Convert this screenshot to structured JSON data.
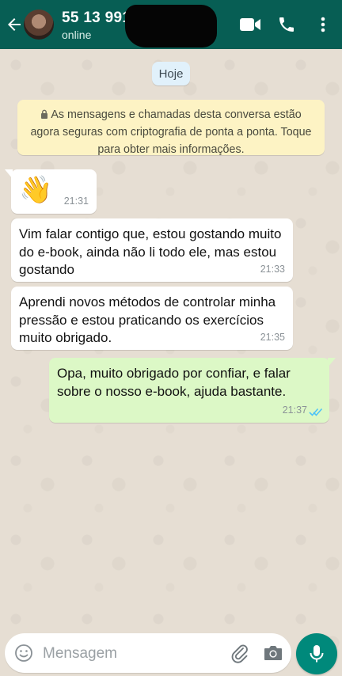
{
  "header": {
    "contact_name": "55 13 991",
    "status": "online",
    "icons": [
      "back-arrow-icon",
      "video-call-icon",
      "phone-icon",
      "more-vertical-icon"
    ],
    "color": "#075e54"
  },
  "chat": {
    "date_chip": "Hoje",
    "encryption_notice": "As mensagens e chamadas desta conversa estão agora seguras com criptografia de ponta a ponta. Toque para obter mais informações.",
    "messages": [
      {
        "direction": "incoming",
        "emoji": "👋",
        "text": "",
        "time": "21:31"
      },
      {
        "direction": "incoming",
        "text": "Vim falar contigo que, estou gostando muito do e-book, ainda não li todo ele, mas estou gostando",
        "time": "21:33"
      },
      {
        "direction": "incoming",
        "text": "Aprendi novos métodos de controlar minha pressão e estou praticando os exercícios muito obrigado.",
        "time": "21:35"
      },
      {
        "direction": "outgoing",
        "text": "Opa, muito obrigado por confiar, e falar sobre o nosso e-book, ajuda bastante.",
        "time": "21:37",
        "read": true
      }
    ],
    "colors": {
      "incoming": "#ffffff",
      "outgoing": "#dcf8c6",
      "read_ticks": "#4fc3f7"
    }
  },
  "composer": {
    "placeholder": "Mensagem",
    "icons": [
      "emoji-icon",
      "attach-icon",
      "camera-icon",
      "mic-icon"
    ],
    "mic_color": "#00897b"
  }
}
